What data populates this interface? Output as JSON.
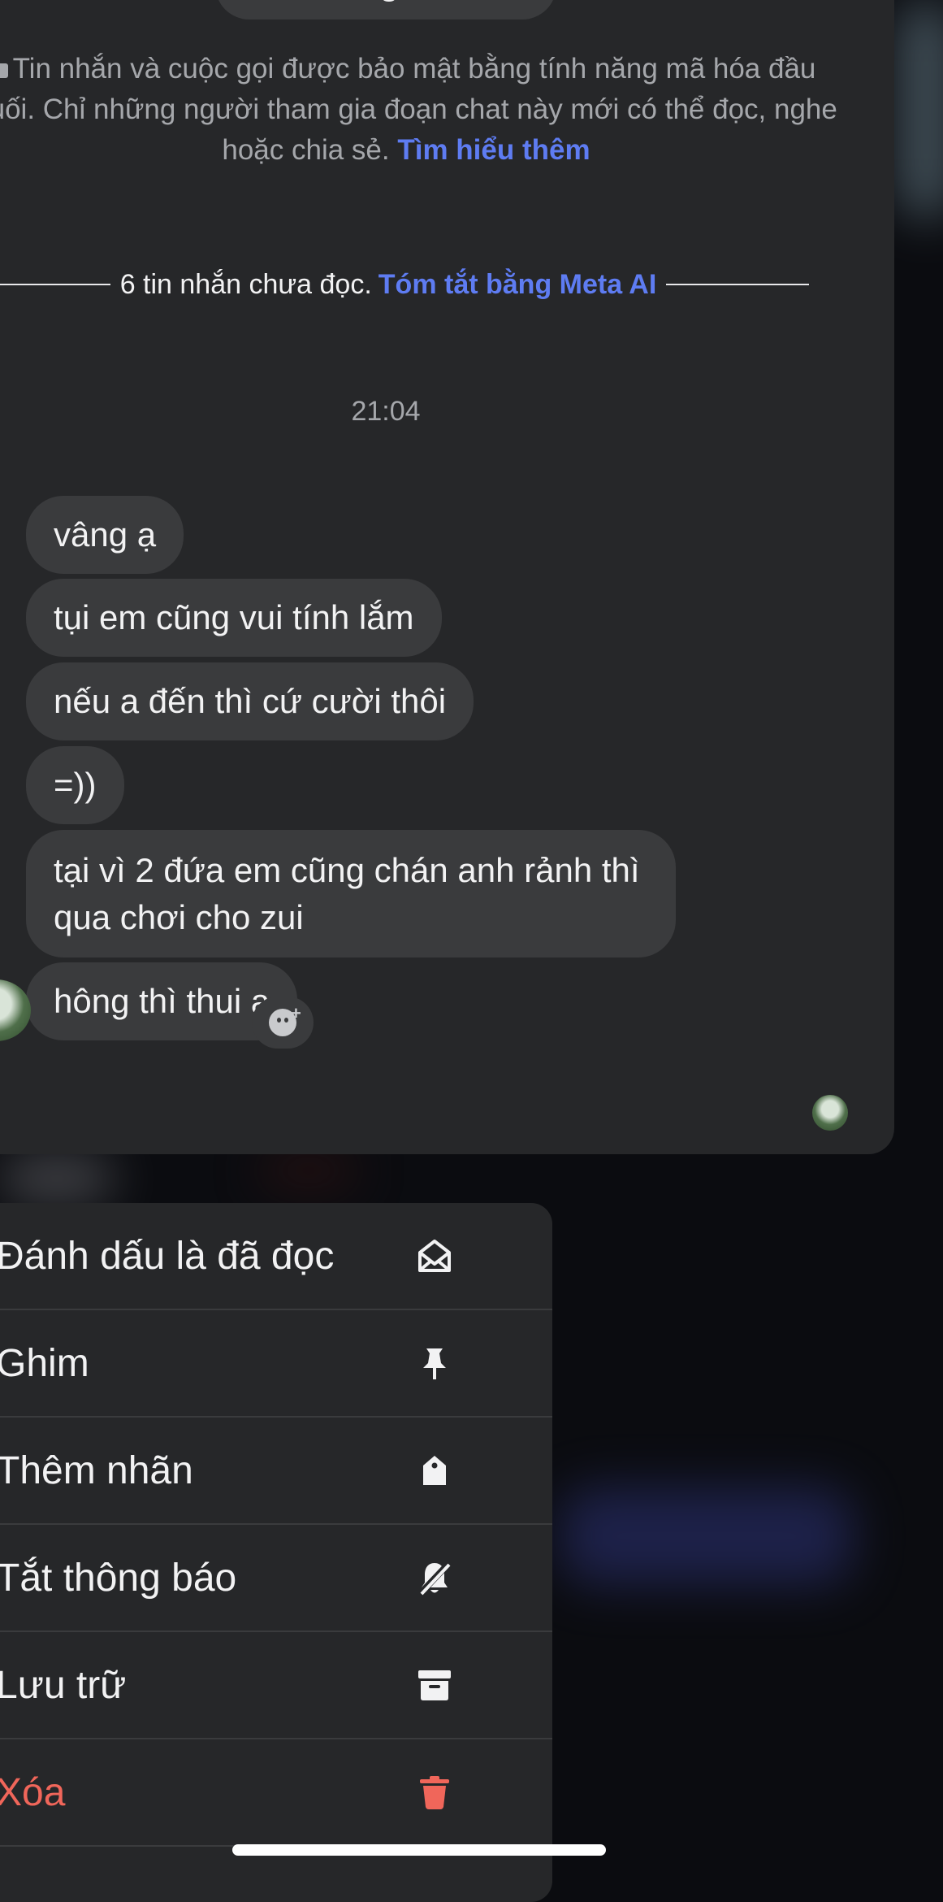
{
  "chat": {
    "profile_button": "Xem trang cá nhân",
    "encryption_notice": "Tin nhắn và cuộc gọi được bảo mật bằng tính năng mã hóa đầu cuối. Chỉ những người tham gia đoạn chat này mới có thể đọc, nghe hoặc chia sẻ.",
    "encryption_link": "Tìm hiểu thêm",
    "unread_text": "6 tin nhắn chưa đọc.",
    "unread_link": "Tóm tắt bằng Meta AI",
    "timestamp": "21:04",
    "messages": [
      {
        "text": "vâng ạ"
      },
      {
        "text": "tụi em cũng vui tính lắm"
      },
      {
        "text": "nếu a đến thì cứ cười thôi"
      },
      {
        "text": "=))"
      },
      {
        "text": "tại vì 2 đứa em cũng chán anh rảnh thì qua chơi cho zui"
      },
      {
        "text": "hông thì thui ạ"
      }
    ]
  },
  "menu": {
    "items": [
      {
        "label": "Đánh dấu là đã đọc",
        "icon": "envelope-open-icon"
      },
      {
        "label": "Ghim",
        "icon": "pin-icon"
      },
      {
        "label": "Thêm nhãn",
        "icon": "tag-icon"
      },
      {
        "label": "Tắt thông báo",
        "icon": "bell-slash-icon"
      },
      {
        "label": "Lưu trữ",
        "icon": "archive-icon"
      },
      {
        "label": "Xóa",
        "icon": "trash-icon"
      }
    ]
  },
  "colors": {
    "link": "#5e7cf2",
    "danger": "#f0665a",
    "bubble": "#3a3b3d",
    "card": "#262729"
  }
}
